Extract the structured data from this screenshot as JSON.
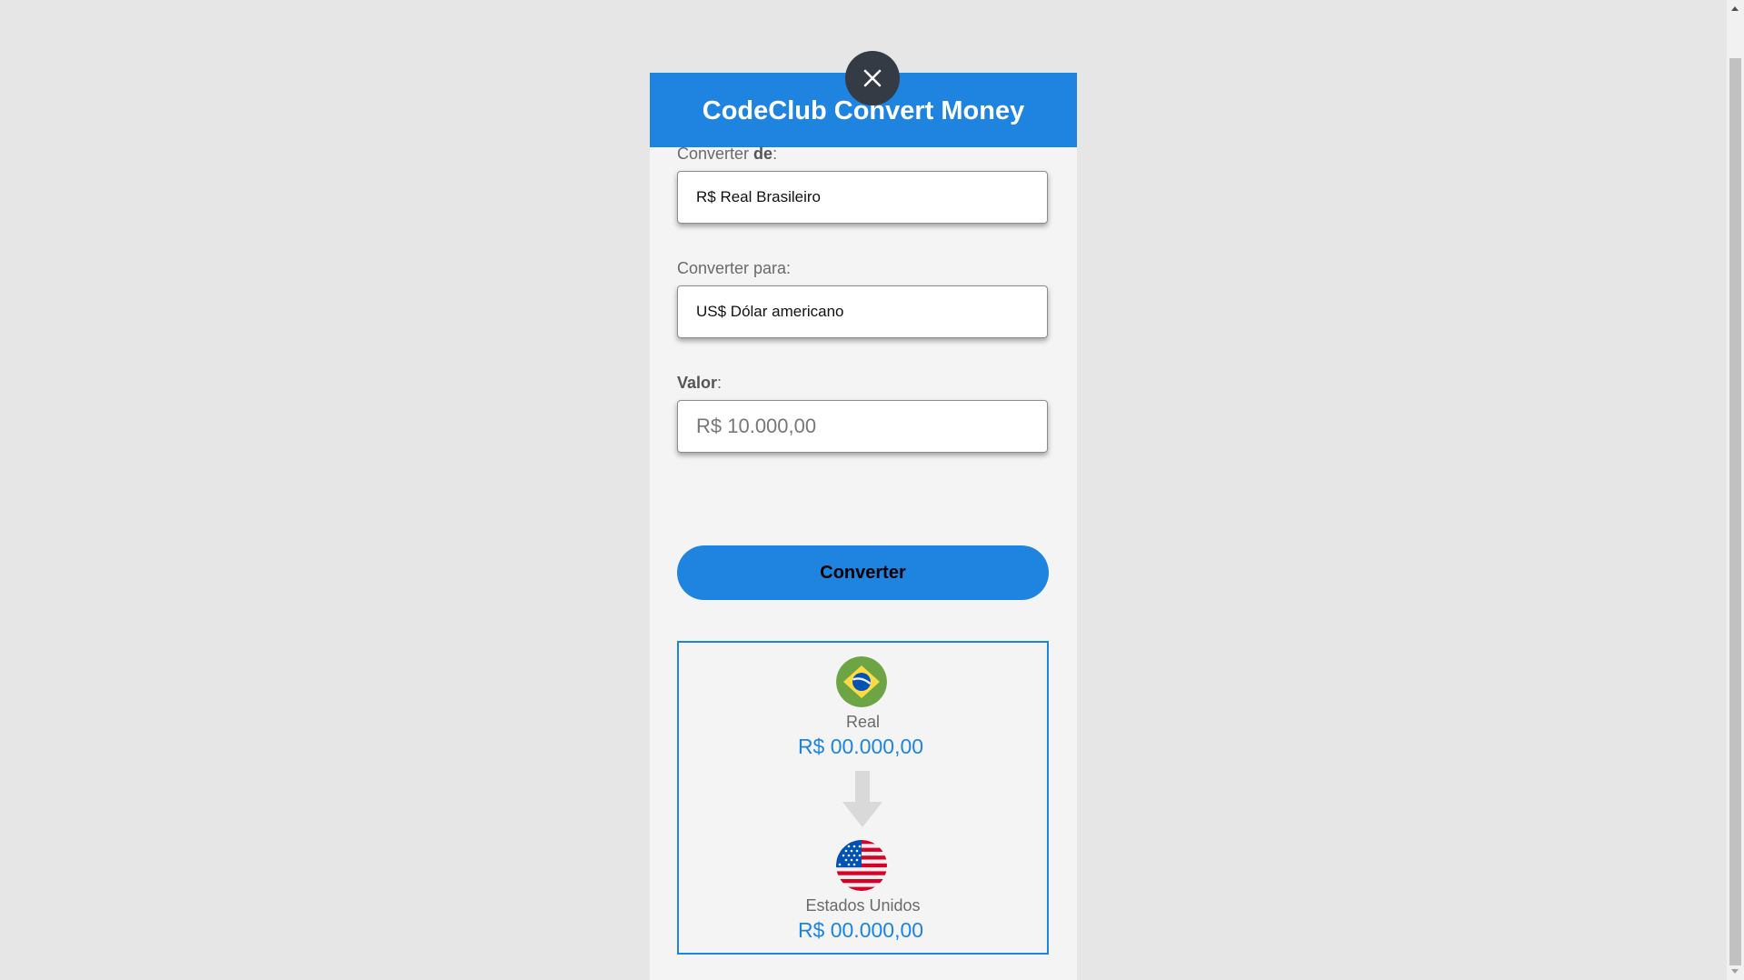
{
  "app": {
    "title": "CodeClub Convert Money"
  },
  "form": {
    "from_label_prefix": "Converter ",
    "from_label_bold": "de",
    "from_label_suffix": ":",
    "from_value": "R$ Real Brasileiro",
    "to_label": "Converter para:",
    "to_value": "US$ Dólar americano",
    "amount_label_bold": "Valor",
    "amount_label_suffix": ":",
    "amount_placeholder": "R$ 10.000,00",
    "convert_button": "Converter"
  },
  "result": {
    "from_currency": "Real",
    "from_value": "R$ 00.000,00",
    "to_currency": "Estados Unidos",
    "to_value": "R$ 00.000,00"
  },
  "icons": {
    "close": "close-icon",
    "from_flag": "brazil-flag-icon",
    "to_flag": "usa-flag-icon",
    "arrow": "arrow-down-icon"
  },
  "colors": {
    "primary": "#1e84e0",
    "close_button": "#343b44",
    "background": "#e6e6e6",
    "card": "#f4f4f4"
  }
}
